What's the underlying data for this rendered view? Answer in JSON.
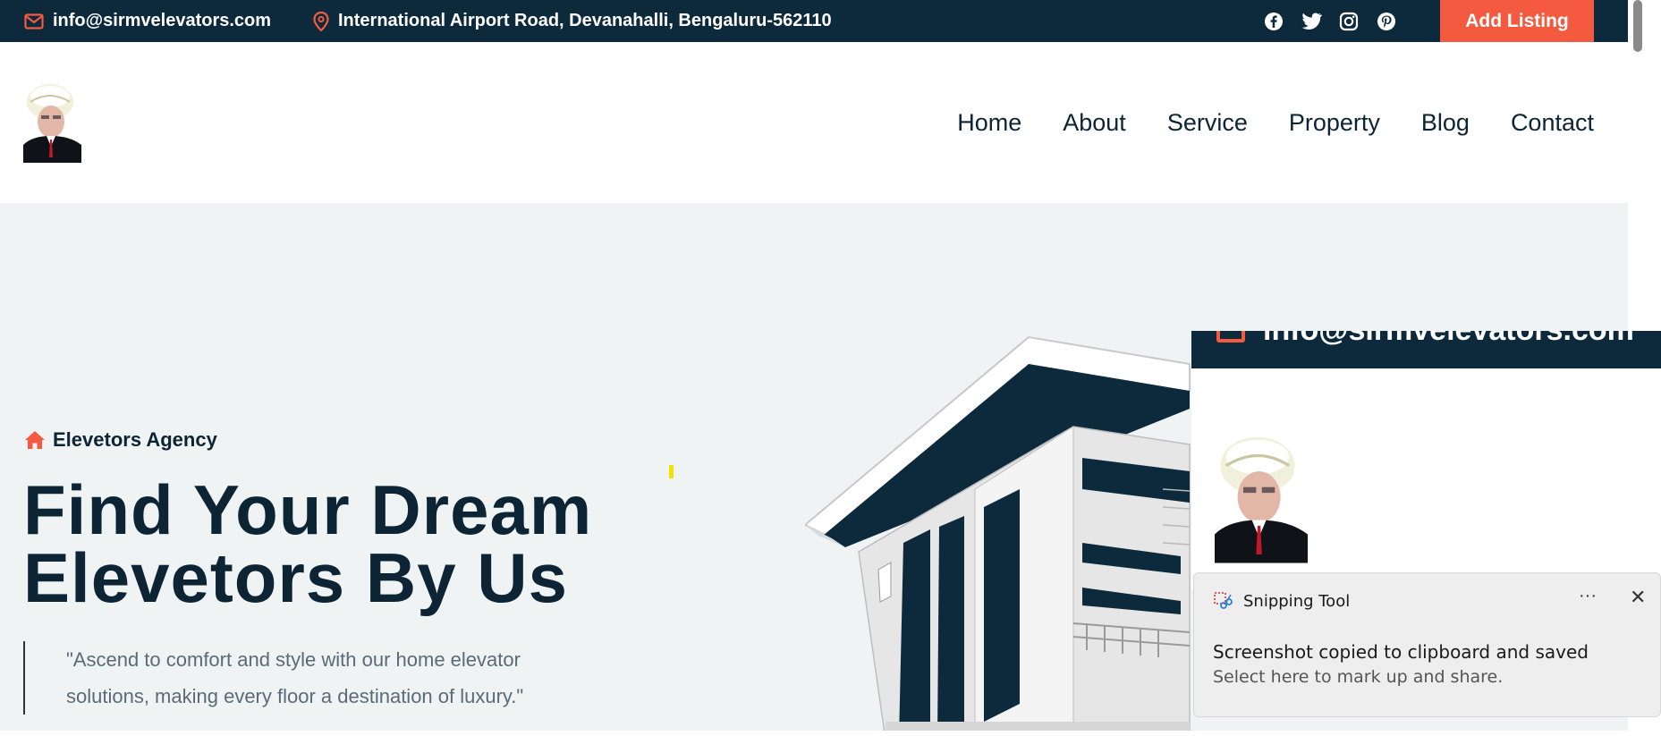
{
  "topbar": {
    "email": "info@sirmvelevators.com",
    "address": "International Airport Road, Devanahalli, Bengaluru-562110",
    "socials": [
      "facebook-icon",
      "twitter-icon",
      "instagram-icon",
      "pinterest-icon"
    ],
    "add_listing": "Add Listing"
  },
  "nav": {
    "items": [
      "Home",
      "About",
      "Service",
      "Property",
      "Blog",
      "Contact"
    ]
  },
  "hero": {
    "tagline": "Elevetors Agency",
    "heading_line1": "Find Your Dream",
    "heading_line2": "Elevetors By Us",
    "quote": "\"Ascend to comfort and style with our home elevator solutions, making every floor a destination of luxury.\""
  },
  "preview": {
    "email": "info@sirmvelevators.com"
  },
  "toast": {
    "app": "Snipping Tool",
    "more": "···",
    "close": "✕",
    "title": "Screenshot copied to clipboard and saved",
    "subtitle": "Select here to mark up and share."
  },
  "colors": {
    "navy": "#0c2a3c",
    "accent": "#f35a3f",
    "hero_bg": "#f0f3f4"
  }
}
